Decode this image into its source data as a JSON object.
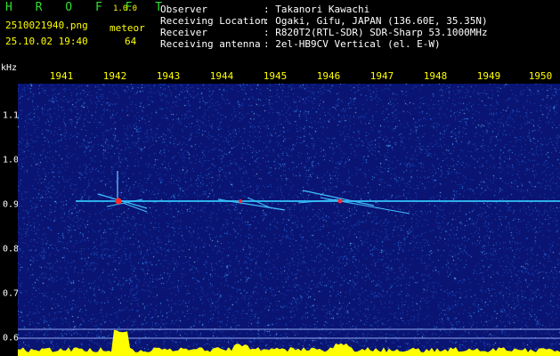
{
  "header": {
    "app_title": "H R O F F T",
    "app_version": "1.0.0",
    "filename": "2510021940.png",
    "datetime": "25.10.02 19:40",
    "meteor_label": "meteor",
    "meteor_count": "64"
  },
  "info": [
    {
      "key": "Observer",
      "value": ": Takanori Kawachi"
    },
    {
      "key": "Receiving Location",
      "value": ": Ogaki, Gifu, JAPAN (136.60E, 35.35N)"
    },
    {
      "key": "Receiver",
      "value": ": R820T2(RTL-SDR) SDR-Sharp 53.1000MHz"
    },
    {
      "key": "Receiving antenna",
      "value": ": 2el-HB9CV Vertical (el. E-W)"
    }
  ],
  "axis": {
    "unit": "kHz",
    "x_ticks": [
      "1941",
      "1942",
      "1943",
      "1944",
      "1945",
      "1946",
      "1947",
      "1948",
      "1949",
      "1950"
    ],
    "y_ticks": [
      "1.1",
      "1.0",
      "0.9",
      "0.8",
      "0.7",
      "0.6"
    ]
  },
  "colors": {
    "background": "#0a1472",
    "noise": "#3aa0ff",
    "carrier": "#33c8ff",
    "hot": "#ff2a2a",
    "level": "#ffff00",
    "text_yellow": "#ffff00",
    "title_green": "#2fe02f"
  }
}
